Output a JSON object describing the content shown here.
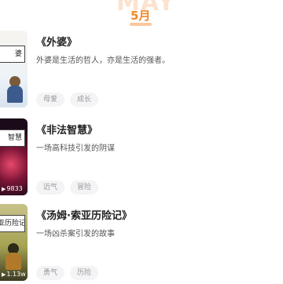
{
  "month": {
    "watermark": "MAY",
    "label": "5月"
  },
  "items": [
    {
      "title": "《外婆》",
      "description": "外婆是生活的哲人，亦是生活的强者。",
      "cover_text": "婆",
      "play_count": "",
      "tags": [
        "母爱",
        "成长"
      ]
    },
    {
      "title": "《非法智慧》",
      "description": "一场高科技引发的阴谋",
      "cover_text": "智慧",
      "play_count": "9833",
      "tags": [
        "迈气",
        "冒险"
      ]
    },
    {
      "title": "《汤姆·索亚历险记》",
      "description": "一场凶杀案引发的故事",
      "cover_text": "亚历险记",
      "play_count": "1.13w",
      "tags": [
        "勇气",
        "历险"
      ]
    }
  ],
  "colors": {
    "accent": "#f08a2a",
    "tag_bg": "#f4f4f6",
    "tag_text": "#999999"
  },
  "icons": {
    "play": "play-icon"
  }
}
